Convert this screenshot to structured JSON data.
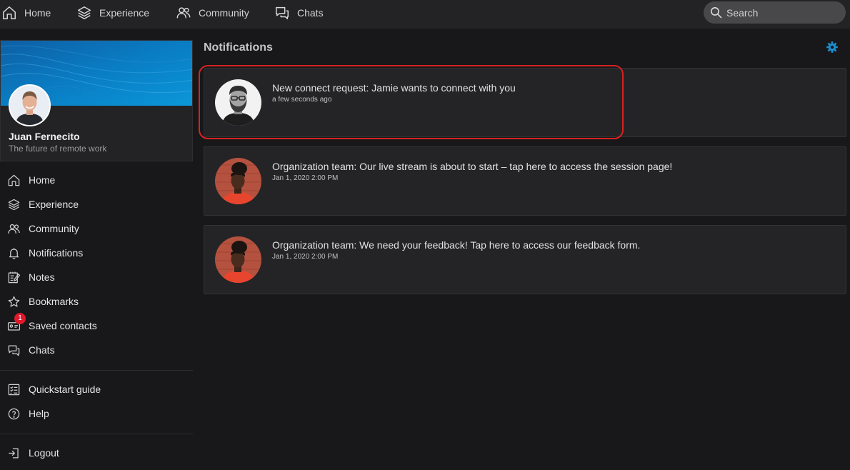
{
  "topnav": {
    "items": [
      {
        "label": "Home",
        "icon": "home-icon"
      },
      {
        "label": "Experience",
        "icon": "layers-icon"
      },
      {
        "label": "Community",
        "icon": "people-icon"
      },
      {
        "label": "Chats",
        "icon": "chat-icon"
      }
    ],
    "search": {
      "placeholder": "Search",
      "icon": "search-icon"
    }
  },
  "profile": {
    "name": "Juan Fernecito",
    "tagline": "The future of remote work"
  },
  "sidebar": {
    "items": [
      {
        "label": "Home",
        "icon": "home-icon"
      },
      {
        "label": "Experience",
        "icon": "layers-icon"
      },
      {
        "label": "Community",
        "icon": "people-icon"
      },
      {
        "label": "Notifications",
        "icon": "bell-icon"
      },
      {
        "label": "Notes",
        "icon": "notes-icon"
      },
      {
        "label": "Bookmarks",
        "icon": "star-icon"
      },
      {
        "label": "Saved contacts",
        "icon": "contact-card-icon",
        "badge": "1"
      },
      {
        "label": "Chats",
        "icon": "chat-icon"
      }
    ],
    "secondary": [
      {
        "label": "Quickstart guide",
        "icon": "checklist-icon"
      },
      {
        "label": "Help",
        "icon": "help-icon"
      }
    ],
    "footer": [
      {
        "label": "Logout",
        "icon": "logout-icon"
      }
    ]
  },
  "main": {
    "title": "Notifications",
    "settings_icon": "gear-icon",
    "notifications": [
      {
        "text": "New connect request: Jamie wants to connect with you",
        "time": "a few seconds ago",
        "highlighted": true
      },
      {
        "text": "Organization team: Our live stream is about to start – tap here to access the session page!",
        "time": "Jan 1, 2020 2:00 PM"
      },
      {
        "text": "Organization team: We need your feedback! Tap here to access our feedback form.",
        "time": "Jan 1, 2020 2:00 PM"
      }
    ]
  },
  "colors": {
    "background": "#18181a",
    "topbar": "#232325",
    "card": "#242426",
    "accent": "#1a8fd1",
    "badge": "#e0192b",
    "highlight": "#d8221f"
  }
}
